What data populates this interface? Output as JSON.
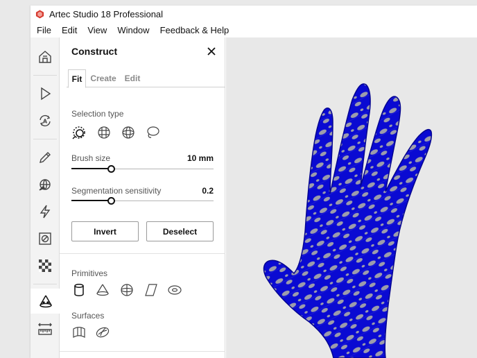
{
  "window": {
    "title": "Artec Studio 18 Professional",
    "accent_color": "#d63a2f"
  },
  "menu": [
    "File",
    "Edit",
    "View",
    "Window",
    "Feedback & Help"
  ],
  "toolbar": {
    "tools": [
      "home-icon",
      "play-icon",
      "autopilot-icon",
      "pencil-icon",
      "brush-globe-icon",
      "lightning-icon",
      "erase-square-icon",
      "texture-checker-icon",
      "construct-cone-icon",
      "ruler-icon"
    ],
    "active": "construct-cone-icon"
  },
  "panel": {
    "title": "Construct",
    "tabs": [
      "Fit",
      "Create",
      "Edit"
    ],
    "active_tab": "Fit",
    "selection_type_label": "Selection type",
    "selection_types": [
      "lasso-brush-icon",
      "grid-select-icon",
      "sphere-select-icon",
      "lasso-select-icon"
    ],
    "brush_size": {
      "label": "Brush size",
      "value": "10 mm",
      "fraction": 0.28
    },
    "segmentation_sensitivity": {
      "label": "Segmentation sensitivity",
      "value": "0.2",
      "fraction": 0.28
    },
    "invert_label": "Invert",
    "deselect_label": "Deselect",
    "primitives_label": "Primitives",
    "primitives": [
      "cylinder-icon",
      "cone-icon",
      "sphere-icon",
      "plane-icon",
      "torus-icon"
    ],
    "surfaces_label": "Surfaces",
    "surfaces": [
      "freeform-surface-icon",
      "ellipsoid-surface-icon"
    ]
  },
  "viewport": {
    "model": "hand-mesh",
    "selection_color": "#0a0ad2",
    "mesh_color": "#9c9cab",
    "background": "#e8e8e8"
  }
}
